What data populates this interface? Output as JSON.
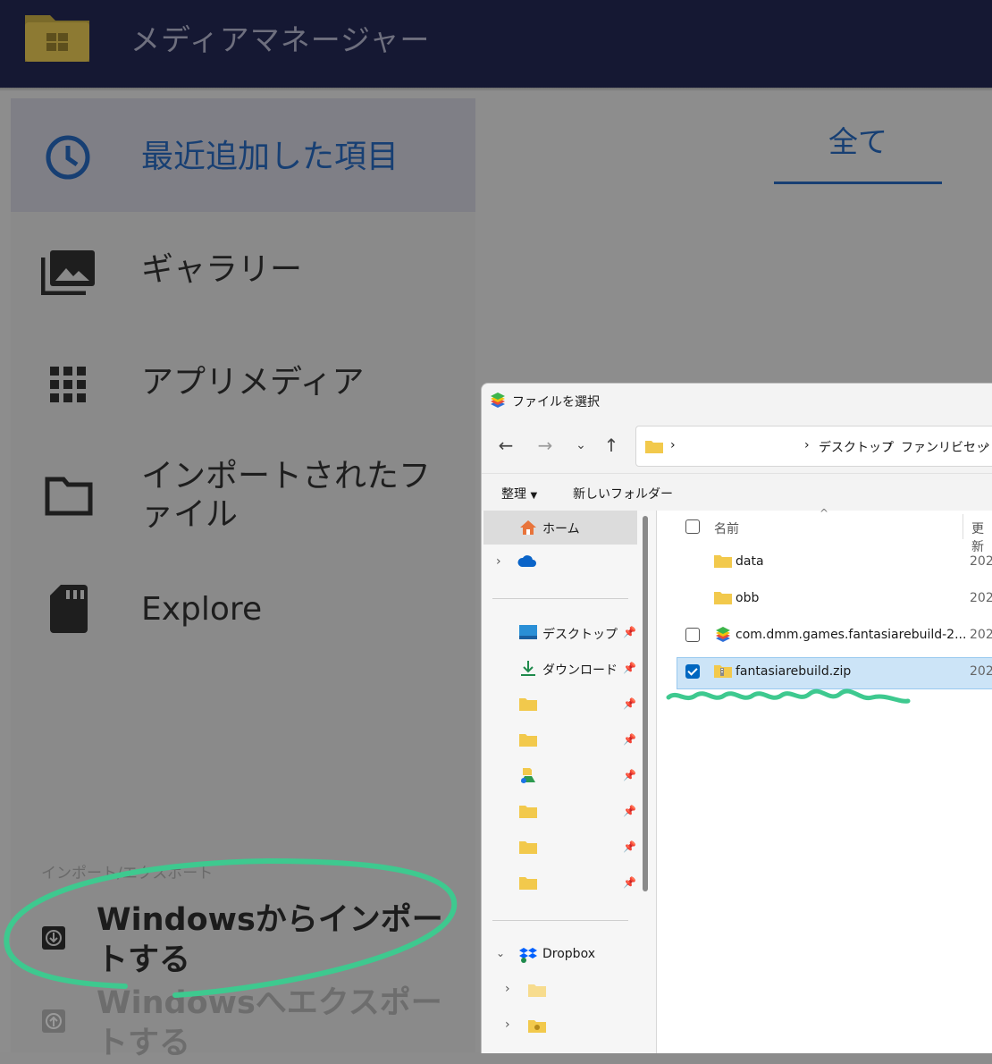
{
  "app": {
    "title": "メディアマネージャー",
    "nav": [
      {
        "label": "最近追加した項目",
        "icon": "clock-icon",
        "selected": true
      },
      {
        "label": "ギャラリー",
        "icon": "photo-library-icon"
      },
      {
        "label": "アプリメディア",
        "icon": "grid-icon"
      },
      {
        "label": "インポートされたファイル",
        "icon": "folder-icon"
      },
      {
        "label": "Explore",
        "icon": "sd-card-icon"
      }
    ],
    "tab_all": "全て",
    "section_header": "インポート/エクスポート",
    "import_label": "Windowsからインポートする",
    "export_label": "Windowsへエクスポートする"
  },
  "dialog": {
    "title": "ファイルを選択",
    "address": {
      "crumbs": [
        "デスクトップ",
        "ファンリビセット"
      ],
      "separator": "›"
    },
    "commands": {
      "organize": "整理",
      "new_folder": "新しいフォルダー"
    },
    "tree": {
      "home": "ホーム",
      "desktop": "デスクトップ",
      "downloads": "ダウンロード",
      "dropbox": "Dropbox"
    },
    "columns": {
      "name": "名前",
      "date": "更新"
    },
    "files": [
      {
        "name": "data",
        "type": "folder",
        "date": "202",
        "checked": false
      },
      {
        "name": "obb",
        "type": "folder",
        "date": "202",
        "checked": false
      },
      {
        "name": "com.dmm.games.fantasiarebuild-2...",
        "type": "apk",
        "date": "202",
        "checked": false
      },
      {
        "name": "fantasiarebuild.zip",
        "type": "zip",
        "date": "202",
        "checked": true
      }
    ]
  },
  "colors": {
    "header_bg": "#151833",
    "accent_dark": "#173f73",
    "annotation_green": "#3ec98f",
    "selection_blue": "#cce4f7"
  }
}
